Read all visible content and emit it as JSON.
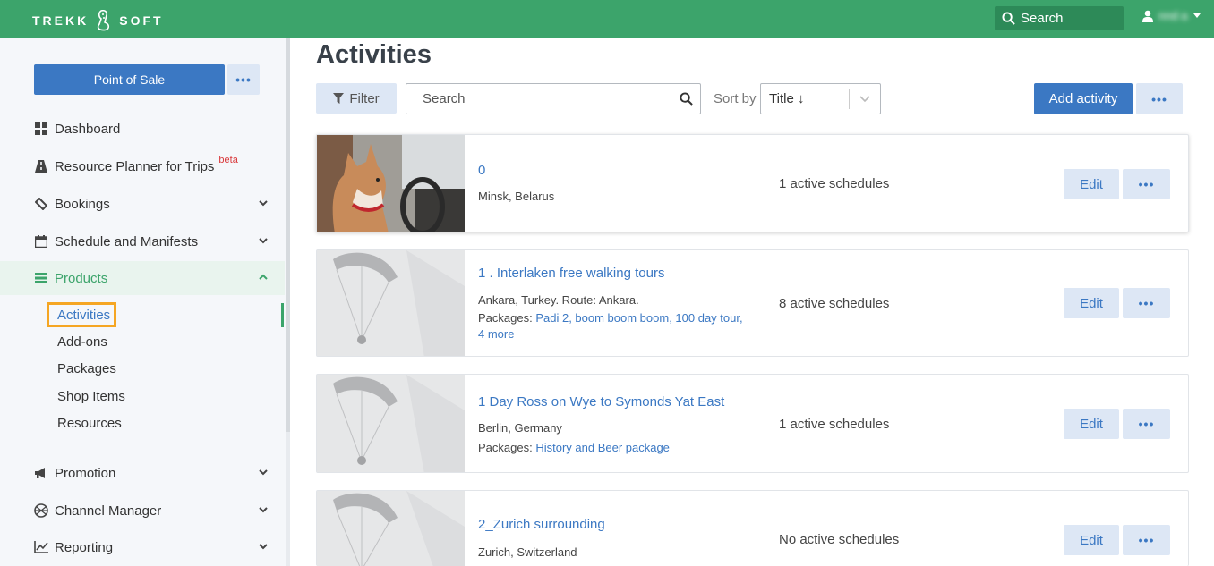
{
  "brand": {
    "left": "TREKK",
    "right": "SOFT"
  },
  "topbar": {
    "search_label": "Search",
    "user_name": "nnd a"
  },
  "sidebar": {
    "pos_button": "Point of Sale",
    "more_label": "•••",
    "items": [
      {
        "label": "Dashboard",
        "icon": "dashboard-icon"
      },
      {
        "label": "Resource Planner for Trips",
        "icon": "road-icon",
        "badge": "beta"
      },
      {
        "label": "Bookings",
        "icon": "ticket-icon"
      },
      {
        "label": "Schedule and Manifests",
        "icon": "calendar-icon"
      },
      {
        "label": "Products",
        "icon": "list-icon"
      },
      {
        "label": "Promotion",
        "icon": "megaphone-icon"
      },
      {
        "label": "Channel Manager",
        "icon": "globe-icon"
      },
      {
        "label": "Reporting",
        "icon": "chart-icon"
      }
    ],
    "sub_items": [
      "Activities",
      "Add-ons",
      "Packages",
      "Shop Items",
      "Resources"
    ]
  },
  "main": {
    "title": "Activities",
    "filter_label": "Filter",
    "search_placeholder": "Search",
    "sort_label": "Sort by",
    "sort_value": "Title ↓",
    "add_button": "Add activity",
    "more_label": "•••",
    "edit_label": "Edit",
    "packages_label": "Packages:",
    "activities": [
      {
        "title": "0",
        "location": "Minsk, Belarus",
        "packages": "",
        "schedules": "1 active schedules"
      },
      {
        "title": "1 . Interlaken free walking tours",
        "location": "Ankara, Turkey. Route: Ankara.",
        "packages": "Padi 2, boom boom boom, 100 day tour, 4 more",
        "schedules": "8 active schedules"
      },
      {
        "title": "1 Day Ross on Wye to Symonds Yat East",
        "location": "Berlin, Germany",
        "packages": "History and Beer package",
        "schedules": "1 active schedules"
      },
      {
        "title": "2_Zurich surrounding",
        "location": "Zurich, Switzerland",
        "packages": "",
        "schedules": "No active schedules"
      }
    ]
  },
  "colors": {
    "brand_green": "#3ca46b",
    "primary_blue": "#3b78c3",
    "light_blue": "#dde7f5",
    "highlight_orange": "#f5a623"
  }
}
